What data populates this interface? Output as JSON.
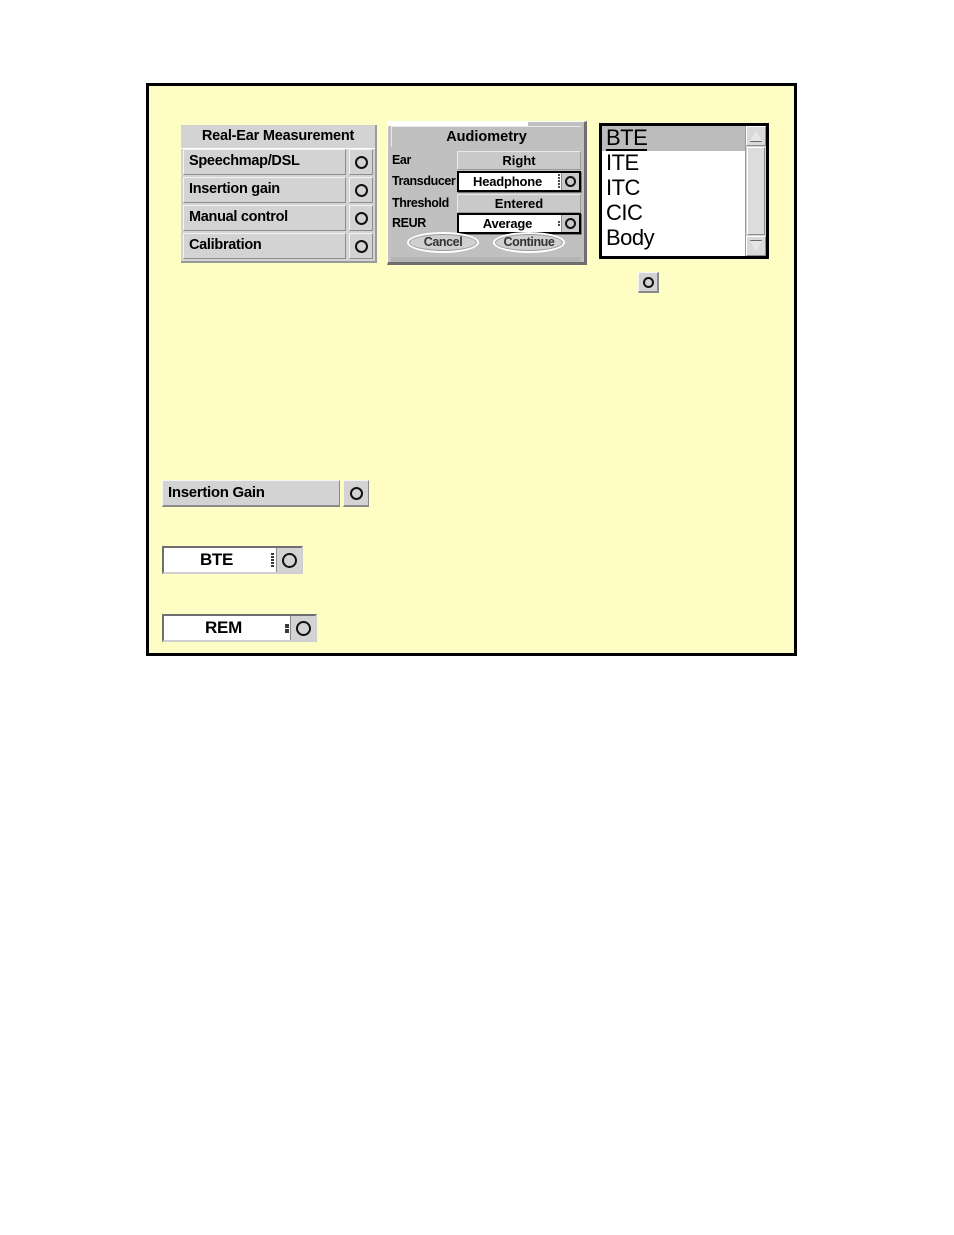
{
  "figure": {
    "background_color": "#fdfdc4",
    "border_color": "#000000"
  },
  "rem_menu": {
    "title": "Real-Ear Measurement",
    "items": [
      {
        "label": "Speechmap/DSL",
        "icon": "knob-circle-icon"
      },
      {
        "label": "Insertion gain",
        "icon": "knob-circle-icon"
      },
      {
        "label": "Manual control",
        "icon": "knob-circle-icon"
      },
      {
        "label": "Calibration",
        "icon": "knob-circle-icon"
      }
    ]
  },
  "audiometry": {
    "title": "Audiometry",
    "rows": [
      {
        "label": "Ear",
        "value": "Right",
        "type": "static"
      },
      {
        "label": "Transducer",
        "value": "Headphone",
        "type": "popup"
      },
      {
        "label": "Threshold",
        "value": "Entered",
        "type": "static"
      },
      {
        "label": "REUR",
        "value": "Average",
        "type": "popup"
      }
    ],
    "cancel_label": "Cancel",
    "continue_label": "Continue"
  },
  "style_listbox": {
    "items": [
      {
        "label": "BTE",
        "selected": true
      },
      {
        "label": "ITE",
        "selected": false
      },
      {
        "label": "ITC",
        "selected": false
      },
      {
        "label": "CIC",
        "selected": false
      },
      {
        "label": "Body",
        "selected": false
      }
    ],
    "scrollbar": {
      "up_arrow_icon": "triangle-up-icon",
      "down_arrow_icon": "triangle-down-icon"
    }
  },
  "standalone_knob": {
    "icon": "knob-circle-icon"
  },
  "lower_widgets": {
    "insertion_gain": {
      "label": "Insertion Gain",
      "icon": "knob-circle-icon"
    },
    "bte_popup": {
      "value": "BTE",
      "icon": "knob-circle-icon"
    },
    "rem_popup": {
      "value": "REM",
      "icon": "knob-circle-icon"
    }
  }
}
